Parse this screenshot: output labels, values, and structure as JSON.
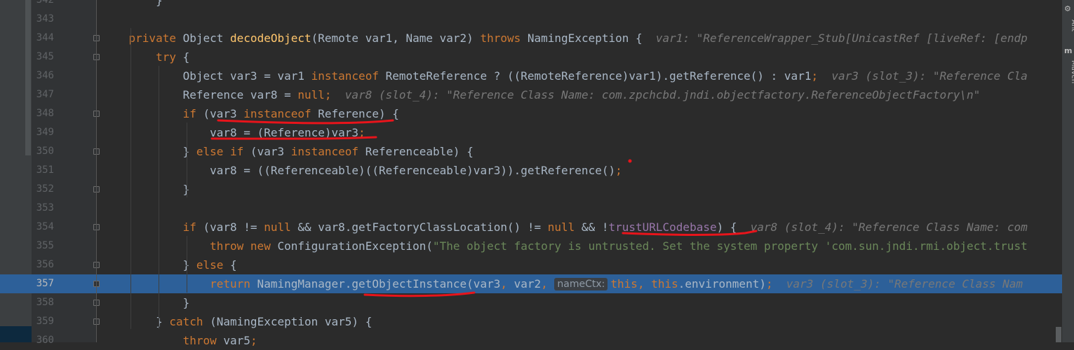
{
  "right_toolbar": {
    "ant_label": "Ant",
    "maven_label": "Maven",
    "ant_icon": "ant-icon",
    "maven_icon": "maven-icon"
  },
  "editor": {
    "first_line": 342,
    "current_line": 357,
    "lines": [
      {
        "number": "342",
        "fold": false,
        "segments": [
          {
            "text": "        }",
            "t": "p"
          }
        ]
      },
      {
        "number": "343",
        "fold": false,
        "segments": [
          {
            "text": "",
            "t": "p"
          }
        ]
      },
      {
        "number": "344",
        "fold": true,
        "segments": [
          {
            "text": "    ",
            "t": "p"
          },
          {
            "text": "private",
            "t": "k"
          },
          {
            "text": " Object ",
            "t": "p"
          },
          {
            "text": "decodeObject",
            "t": "f"
          },
          {
            "text": "(Remote var1, Name var2) ",
            "t": "p"
          },
          {
            "text": "throws",
            "t": "k"
          },
          {
            "text": " NamingException {  ",
            "t": "p"
          },
          {
            "text": "var1: \"ReferenceWrapper_Stub[UnicastRef [liveRef: [endp",
            "t": "h"
          }
        ]
      },
      {
        "number": "345",
        "fold": true,
        "segments": [
          {
            "text": "        ",
            "t": "p"
          },
          {
            "text": "try",
            "t": "k"
          },
          {
            "text": " {",
            "t": "p"
          }
        ]
      },
      {
        "number": "346",
        "fold": false,
        "segments": [
          {
            "text": "            Object var3 = var1 ",
            "t": "p"
          },
          {
            "text": "instanceof",
            "t": "k"
          },
          {
            "text": " RemoteReference ? ((RemoteReference)var1).getReference() : var1",
            "t": "p"
          },
          {
            "text": ";",
            "t": "k"
          },
          {
            "text": "  ",
            "t": "p"
          },
          {
            "text": "var3 (slot_3): \"Reference Cla",
            "t": "h"
          }
        ]
      },
      {
        "number": "347",
        "fold": false,
        "segments": [
          {
            "text": "            Reference var8 = ",
            "t": "p"
          },
          {
            "text": "null",
            "t": "k"
          },
          {
            "text": ";",
            "t": "k"
          },
          {
            "text": "  ",
            "t": "p"
          },
          {
            "text": "var8 (slot_4): \"Reference Class Name: com.zpchcbd.jndi.objectfactory.ReferenceObjectFactory\\n\"",
            "t": "h"
          }
        ]
      },
      {
        "number": "348",
        "fold": true,
        "segments": [
          {
            "text": "            ",
            "t": "p"
          },
          {
            "text": "if",
            "t": "k"
          },
          {
            "text": " (var3 ",
            "t": "p"
          },
          {
            "text": "instanceof",
            "t": "k"
          },
          {
            "text": " Reference) {",
            "t": "p"
          }
        ]
      },
      {
        "number": "349",
        "fold": false,
        "segments": [
          {
            "text": "                var8 = (Reference)var3",
            "t": "p"
          },
          {
            "text": ";",
            "t": "k"
          }
        ]
      },
      {
        "number": "350",
        "fold": true,
        "segments": [
          {
            "text": "            } ",
            "t": "p"
          },
          {
            "text": "else if",
            "t": "k"
          },
          {
            "text": " (var3 ",
            "t": "p"
          },
          {
            "text": "instanceof",
            "t": "k"
          },
          {
            "text": " Referenceable) {",
            "t": "p"
          }
        ]
      },
      {
        "number": "351",
        "fold": false,
        "segments": [
          {
            "text": "                var8 = ((Referenceable)((Referenceable)var3)).getReference()",
            "t": "p"
          },
          {
            "text": ";",
            "t": "k"
          }
        ]
      },
      {
        "number": "352",
        "fold": true,
        "segments": [
          {
            "text": "            }",
            "t": "p"
          }
        ]
      },
      {
        "number": "353",
        "fold": false,
        "segments": [
          {
            "text": "",
            "t": "p"
          }
        ]
      },
      {
        "number": "354",
        "fold": true,
        "segments": [
          {
            "text": "            ",
            "t": "p"
          },
          {
            "text": "if",
            "t": "k"
          },
          {
            "text": " (var8 != ",
            "t": "p"
          },
          {
            "text": "null",
            "t": "k"
          },
          {
            "text": " && var8.getFactoryClassLocation() != ",
            "t": "p"
          },
          {
            "text": "null",
            "t": "k"
          },
          {
            "text": " && !",
            "t": "p"
          },
          {
            "text": "trustURLCodebase",
            "t": "v"
          },
          {
            "text": ") {  ",
            "t": "p"
          },
          {
            "text": "var8 (slot_4): \"Reference Class Name: com",
            "t": "h"
          }
        ]
      },
      {
        "number": "355",
        "fold": false,
        "segments": [
          {
            "text": "                ",
            "t": "p"
          },
          {
            "text": "throw new",
            "t": "k"
          },
          {
            "text": " ConfigurationException(",
            "t": "p"
          },
          {
            "text": "\"The object factory is untrusted. Set the system property 'com.sun.jndi.rmi.object.trust",
            "t": "s"
          }
        ]
      },
      {
        "number": "356",
        "fold": true,
        "segments": [
          {
            "text": "            } ",
            "t": "p"
          },
          {
            "text": "else",
            "t": "k"
          },
          {
            "text": " {",
            "t": "p"
          }
        ]
      },
      {
        "number": "357",
        "fold": true,
        "segments": [
          {
            "text": "                ",
            "t": "p"
          },
          {
            "text": "return",
            "t": "k"
          },
          {
            "text": " NamingManager.getObjectInstance(var3",
            "t": "p"
          },
          {
            "text": ",",
            "t": "k"
          },
          {
            "text": " var2",
            "t": "p"
          },
          {
            "text": ", ",
            "t": "k"
          },
          {
            "text": "nameCtx:",
            "t": "param"
          },
          {
            "text": "this",
            "t": "k"
          },
          {
            "text": ", ",
            "t": "k"
          },
          {
            "text": "this",
            "t": "k"
          },
          {
            "text": ".environment)",
            "t": "p"
          },
          {
            "text": ";",
            "t": "k"
          },
          {
            "text": "  ",
            "t": "p"
          },
          {
            "text": "var3 (slot_3): \"Reference Class Nam",
            "t": "h"
          }
        ]
      },
      {
        "number": "358",
        "fold": true,
        "segments": [
          {
            "text": "            }",
            "t": "p"
          }
        ]
      },
      {
        "number": "359",
        "fold": true,
        "segments": [
          {
            "text": "        } ",
            "t": "p"
          },
          {
            "text": "catch",
            "t": "k"
          },
          {
            "text": " (NamingException var5) {",
            "t": "p"
          }
        ]
      },
      {
        "number": "360",
        "fold": false,
        "segments": [
          {
            "text": "            ",
            "t": "p"
          },
          {
            "text": "throw",
            "t": "k"
          },
          {
            "text": " var5",
            "t": "p"
          },
          {
            "text": ";",
            "t": "k"
          }
        ]
      }
    ]
  },
  "annotations": {
    "underline_color": "#e8141b",
    "underlined_spans": [
      "var3 instanceof Reference",
      "var8 = (Reference)var3;",
      "!trustURLCodebase)",
      "getObjectInstance"
    ]
  }
}
